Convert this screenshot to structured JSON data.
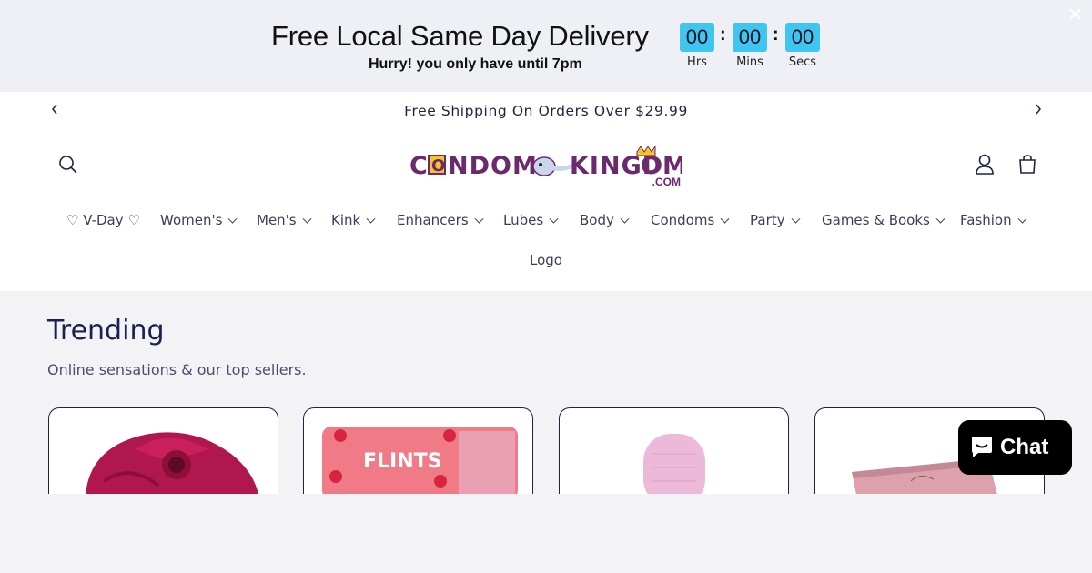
{
  "promo": {
    "title": "Free Local Same Day Delivery",
    "subtitle": "Hurry! you only have until 7pm",
    "countdown": [
      {
        "value": "00",
        "label": "Hrs"
      },
      {
        "value": "00",
        "label": "Mins"
      },
      {
        "value": "00",
        "label": "Secs"
      }
    ],
    "close_icon": "close-icon",
    "accent_color": "#3ec6f0"
  },
  "announcement": {
    "text": "Free Shipping On Orders Over $29.99"
  },
  "header": {
    "logo_text": "CONDOMKINGDOM",
    "logo_suffix": ".COM",
    "icons": [
      "search-icon",
      "account-icon",
      "cart-icon"
    ]
  },
  "nav": {
    "items": [
      {
        "label": "♡ V-Day ♡",
        "has_dropdown": false
      },
      {
        "label": "Women's",
        "has_dropdown": true
      },
      {
        "label": "Men's",
        "has_dropdown": true
      },
      {
        "label": "Kink",
        "has_dropdown": true
      },
      {
        "label": "Enhancers",
        "has_dropdown": true
      },
      {
        "label": "Lubes",
        "has_dropdown": true
      },
      {
        "label": "Body",
        "has_dropdown": true
      },
      {
        "label": "Condoms",
        "has_dropdown": true
      },
      {
        "label": "Party",
        "has_dropdown": true
      },
      {
        "label": "Games & Books",
        "has_dropdown": true
      },
      {
        "label": "Fashion",
        "has_dropdown": true
      }
    ],
    "second_row": "Logo"
  },
  "trending": {
    "title": "Trending",
    "subtitle": "Online sensations & our top sellers.",
    "products": [
      {
        "image": "rose-toy-image"
      },
      {
        "image": "flintts-mints-tin-image",
        "label": "FLINTS"
      },
      {
        "image": "pink-wand-image"
      },
      {
        "image": "pink-box-image"
      }
    ]
  },
  "chat": {
    "label": "Chat"
  }
}
